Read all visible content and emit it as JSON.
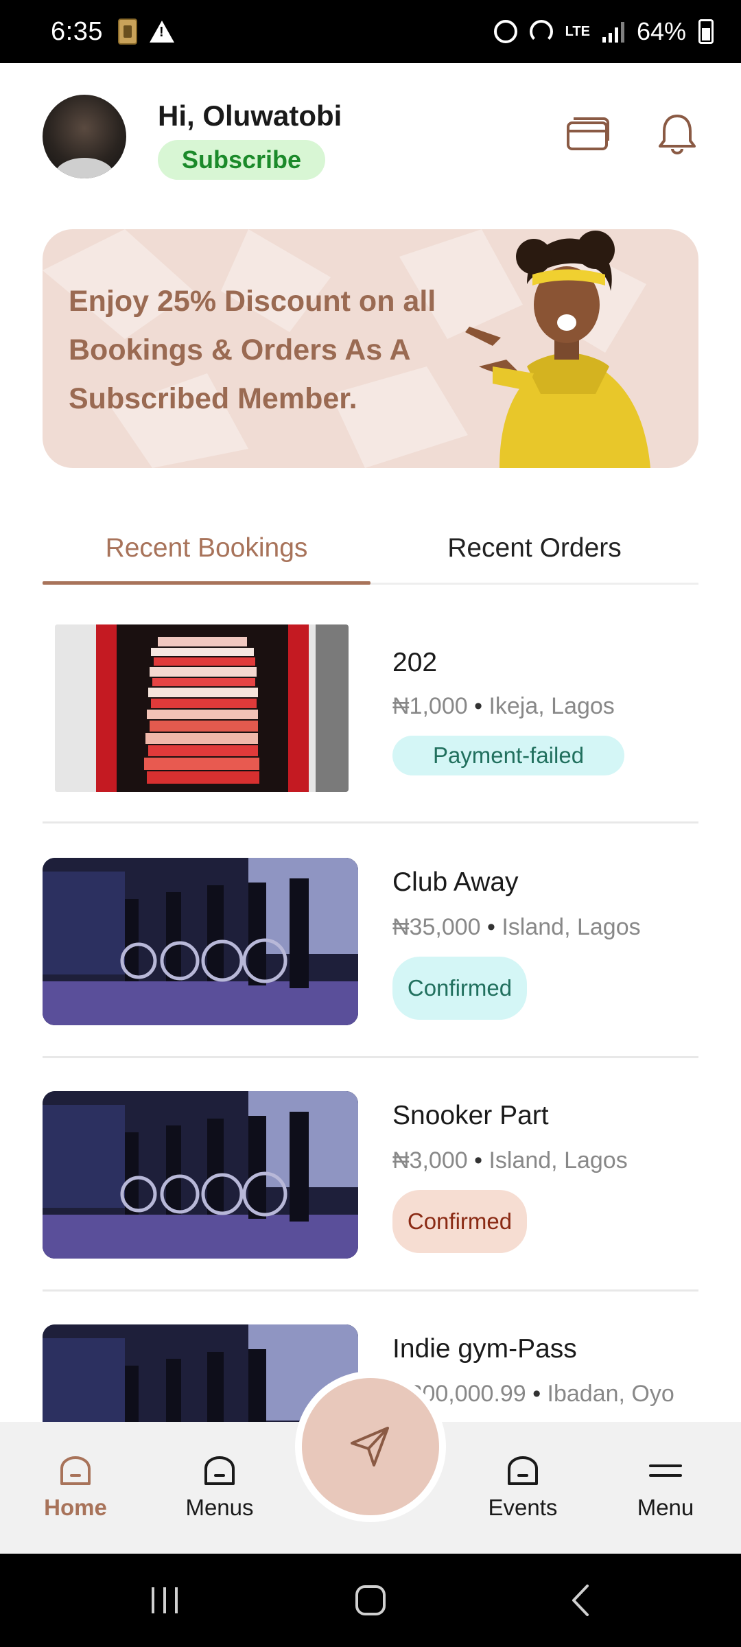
{
  "status_bar": {
    "time": "6:35",
    "lte": "LTE",
    "battery": "64%"
  },
  "header": {
    "greeting": "Hi, Oluwatobi",
    "subscribe_label": "Subscribe"
  },
  "banner": {
    "text": "Enjoy 25% Discount on all Bookings & Orders As A Subscribed Member."
  },
  "tabs": [
    {
      "label": "Recent Bookings",
      "active": true
    },
    {
      "label": "Recent Orders",
      "active": false
    }
  ],
  "bookings": [
    {
      "title": "202",
      "price": "₦1,000",
      "location": "Ikeja, Lagos",
      "status": "Payment-failed"
    },
    {
      "title": "Club Away",
      "price": "₦35,000",
      "location": "Island, Lagos",
      "status": "Confirmed"
    },
    {
      "title": "Snooker Part",
      "price": "₦3,000",
      "location": "Island, Lagos",
      "status": "Confirmed"
    },
    {
      "title": "Indie gym-Pass",
      "price": "₦200,000.99",
      "location": "Ibadan, Oyo",
      "status": ""
    }
  ],
  "bottom_nav": [
    {
      "label": "Home",
      "icon": "home-icon",
      "active": true
    },
    {
      "label": "Menus",
      "icon": "menus-icon",
      "active": false
    },
    {
      "label": "Events",
      "icon": "events-icon",
      "active": false
    },
    {
      "label": "Menu",
      "icon": "menu-icon",
      "active": false
    }
  ],
  "colors": {
    "accent": "#a8735a",
    "banner_bg": "#f0dcd4",
    "subscribe_bg": "#d8f6d4",
    "status_cyan": "#d4f6f6",
    "status_pink": "#f6ddd2",
    "fab": "#e8c8bb"
  }
}
